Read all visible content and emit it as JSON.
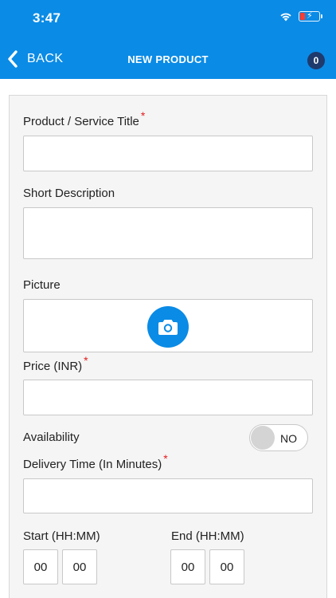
{
  "status_bar": {
    "time": "3:47"
  },
  "nav": {
    "back_label": "BACK",
    "title": "NEW PRODUCT",
    "cart_count": "0"
  },
  "form": {
    "title_label": "Product / Service Title",
    "description_label": "Short Description",
    "picture_label": "Picture",
    "price_label": "Price (INR)",
    "availability_label": "Availability",
    "availability_value": "NO",
    "delivery_label": "Delivery Time (In Minutes)",
    "start_label": "Start (HH:MM)",
    "end_label": "End (HH:MM)",
    "start_hh": "00",
    "start_mm": "00",
    "end_hh": "00",
    "end_mm": "00",
    "required_mark": "*"
  },
  "colors": {
    "accent": "#0a8be6",
    "badge": "#1f3a6d",
    "required": "#e41c1c"
  }
}
